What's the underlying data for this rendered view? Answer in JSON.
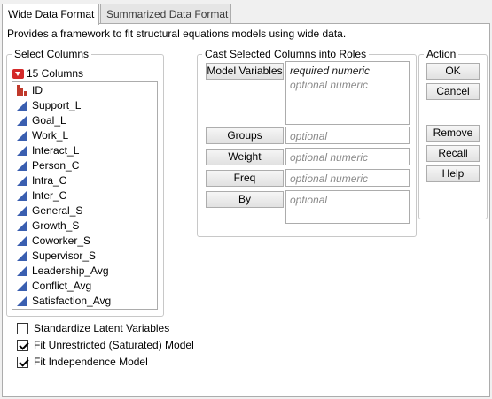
{
  "tabs": [
    {
      "label": "Wide Data Format",
      "active": true
    },
    {
      "label": "Summarized Data Format",
      "active": false
    }
  ],
  "description": "Provides a framework to fit structural equations models using wide data.",
  "select_columns": {
    "title": "Select Columns",
    "count_label": "15 Columns",
    "columns": [
      {
        "name": "ID",
        "icon": "nominal-bar-icon"
      },
      {
        "name": "Support_L",
        "icon": "continuous-icon"
      },
      {
        "name": "Goal_L",
        "icon": "continuous-icon"
      },
      {
        "name": "Work_L",
        "icon": "continuous-icon"
      },
      {
        "name": "Interact_L",
        "icon": "continuous-icon"
      },
      {
        "name": "Person_C",
        "icon": "continuous-icon"
      },
      {
        "name": "Intra_C",
        "icon": "continuous-icon"
      },
      {
        "name": "Inter_C",
        "icon": "continuous-icon"
      },
      {
        "name": "General_S",
        "icon": "continuous-icon"
      },
      {
        "name": "Growth_S",
        "icon": "continuous-icon"
      },
      {
        "name": "Coworker_S",
        "icon": "continuous-icon"
      },
      {
        "name": "Supervisor_S",
        "icon": "continuous-icon"
      },
      {
        "name": "Leadership_Avg",
        "icon": "continuous-icon"
      },
      {
        "name": "Conflict_Avg",
        "icon": "continuous-icon"
      },
      {
        "name": "Satisfaction_Avg",
        "icon": "continuous-icon"
      }
    ]
  },
  "cast_roles": {
    "title": "Cast Selected Columns into Roles",
    "model_variables": {
      "label": "Model Variables",
      "required": "required numeric",
      "optional": "optional numeric"
    },
    "groups": {
      "label": "Groups",
      "placeholder": "optional"
    },
    "weight": {
      "label": "Weight",
      "placeholder": "optional numeric"
    },
    "freq": {
      "label": "Freq",
      "placeholder": "optional numeric"
    },
    "by": {
      "label": "By",
      "placeholder": "optional"
    }
  },
  "action": {
    "title": "Action",
    "ok": "OK",
    "cancel": "Cancel",
    "remove": "Remove",
    "recall": "Recall",
    "help": "Help"
  },
  "options": [
    {
      "label": "Standardize Latent Variables",
      "checked": false
    },
    {
      "label": "Fit Unrestricted (Saturated) Model",
      "checked": true
    },
    {
      "label": "Fit Independence Model",
      "checked": true
    }
  ],
  "colors": {
    "continuous_icon": "#3a5fb0",
    "nominal_icon": "#c0392b",
    "collapse_button": "#d42a2a"
  }
}
